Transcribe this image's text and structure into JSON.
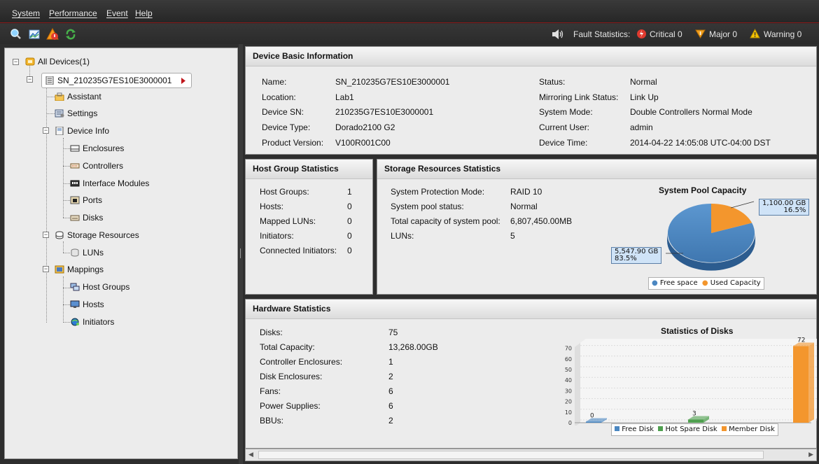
{
  "menubar": {
    "items": [
      "System",
      "Performance",
      "Event",
      "Help"
    ]
  },
  "toolbar": {
    "fault_label": "Fault Statistics:",
    "critical": "Critical 0",
    "major": "Major 0",
    "warning": "Warning 0"
  },
  "tree": {
    "root": "All Devices(1)",
    "device": "SN_210235G7ES10E3000001",
    "assistant": "Assistant",
    "settings": "Settings",
    "device_info": "Device Info",
    "enclosures": "Enclosures",
    "controllers": "Controllers",
    "interface_modules": "Interface Modules",
    "ports": "Ports",
    "disks": "Disks",
    "storage_resources": "Storage Resources",
    "luns": "LUNs",
    "mappings": "Mappings",
    "host_groups": "Host Groups",
    "hosts": "Hosts",
    "initiators": "Initiators"
  },
  "device_info": {
    "title": "Device Basic Information",
    "left": [
      {
        "label": "Name:",
        "value": "SN_210235G7ES10E3000001"
      },
      {
        "label": "Location:",
        "value": "Lab1"
      },
      {
        "label": "Device SN:",
        "value": "210235G7ES10E3000001"
      },
      {
        "label": "Device Type:",
        "value": "Dorado2100 G2"
      },
      {
        "label": "Product Version:",
        "value": "V100R001C00"
      }
    ],
    "right": [
      {
        "label": "Status:",
        "value": "Normal"
      },
      {
        "label": "Mirroring Link Status:",
        "value": "Link Up"
      },
      {
        "label": "System Mode:",
        "value": "Double Controllers Normal Mode"
      },
      {
        "label": "Current User:",
        "value": "admin"
      },
      {
        "label": "Device Time:",
        "value": "2014-04-22 14:05:08 UTC-04:00 DST"
      }
    ]
  },
  "host_group": {
    "title": "Host Group Statistics",
    "rows": [
      {
        "label": "Host Groups:",
        "value": "1"
      },
      {
        "label": "Hosts:",
        "value": "0"
      },
      {
        "label": "Mapped LUNs:",
        "value": "0"
      },
      {
        "label": "Initiators:",
        "value": "0"
      },
      {
        "label": "Connected Initiators:",
        "value": "0"
      }
    ]
  },
  "storage": {
    "title": "Storage Resources Statistics",
    "rows": [
      {
        "label": "System Protection Mode:",
        "value": "RAID 10"
      },
      {
        "label": "System pool status:",
        "value": "Normal"
      },
      {
        "label": "Total capacity of system pool:",
        "value": "6,807,450.00MB"
      },
      {
        "label": "LUNs:",
        "value": "5"
      }
    ]
  },
  "hardware": {
    "title": "Hardware Statistics",
    "rows": [
      {
        "label": "Disks:",
        "value": "75"
      },
      {
        "label": "Total Capacity:",
        "value": "13,268.00GB"
      },
      {
        "label": "Controller Enclosures:",
        "value": "1"
      },
      {
        "label": "Disk Enclosures:",
        "value": "2"
      },
      {
        "label": "Fans:",
        "value": "6"
      },
      {
        "label": "Power Supplies:",
        "value": "6"
      },
      {
        "label": "BBUs:",
        "value": "2"
      }
    ]
  },
  "chart_data": [
    {
      "type": "pie",
      "title": "System Pool Capacity",
      "slices": [
        {
          "name": "Free space",
          "value": 5547.9,
          "label_value": "5,547.90 GB",
          "label_pct": "83.5%",
          "color": "#4b87c1"
        },
        {
          "name": "Used Capacity",
          "value": 1100.0,
          "label_value": "1,100.00 GB",
          "label_pct": "16.5%",
          "color": "#f3962d"
        }
      ],
      "legend_position": "bottom"
    },
    {
      "type": "bar",
      "title": "Statistics of Disks",
      "categories": [
        "Free Disk",
        "Hot Spare Disk",
        "Member Disk"
      ],
      "values": [
        0,
        3,
        72
      ],
      "colors": [
        "#4b87c1",
        "#4fa04f",
        "#f3962d"
      ],
      "ylim": [
        0,
        75
      ],
      "yticks": [
        "0",
        "10",
        "20",
        "30",
        "40",
        "50",
        "60",
        "70"
      ],
      "legend_position": "bottom"
    }
  ],
  "colors": {
    "accent_red": "#8b1a1a",
    "critical": "#e03a2f",
    "major": "#f0a020",
    "warning": "#f5c400"
  }
}
